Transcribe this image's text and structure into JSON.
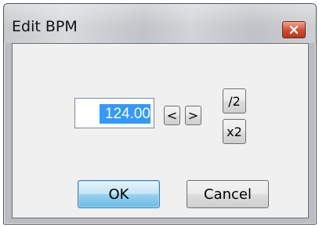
{
  "window": {
    "title": "Edit BPM"
  },
  "bpm": {
    "value": "124.00"
  },
  "buttons": {
    "decrease": "<",
    "increase": ">",
    "halve": "/2",
    "double": "x2",
    "ok": "OK",
    "cancel": "Cancel"
  },
  "icons": {
    "close": "close-icon"
  },
  "colors": {
    "close_button": "#d24a2d",
    "selection": "#3399ff",
    "default_button": "#98d1ef"
  }
}
